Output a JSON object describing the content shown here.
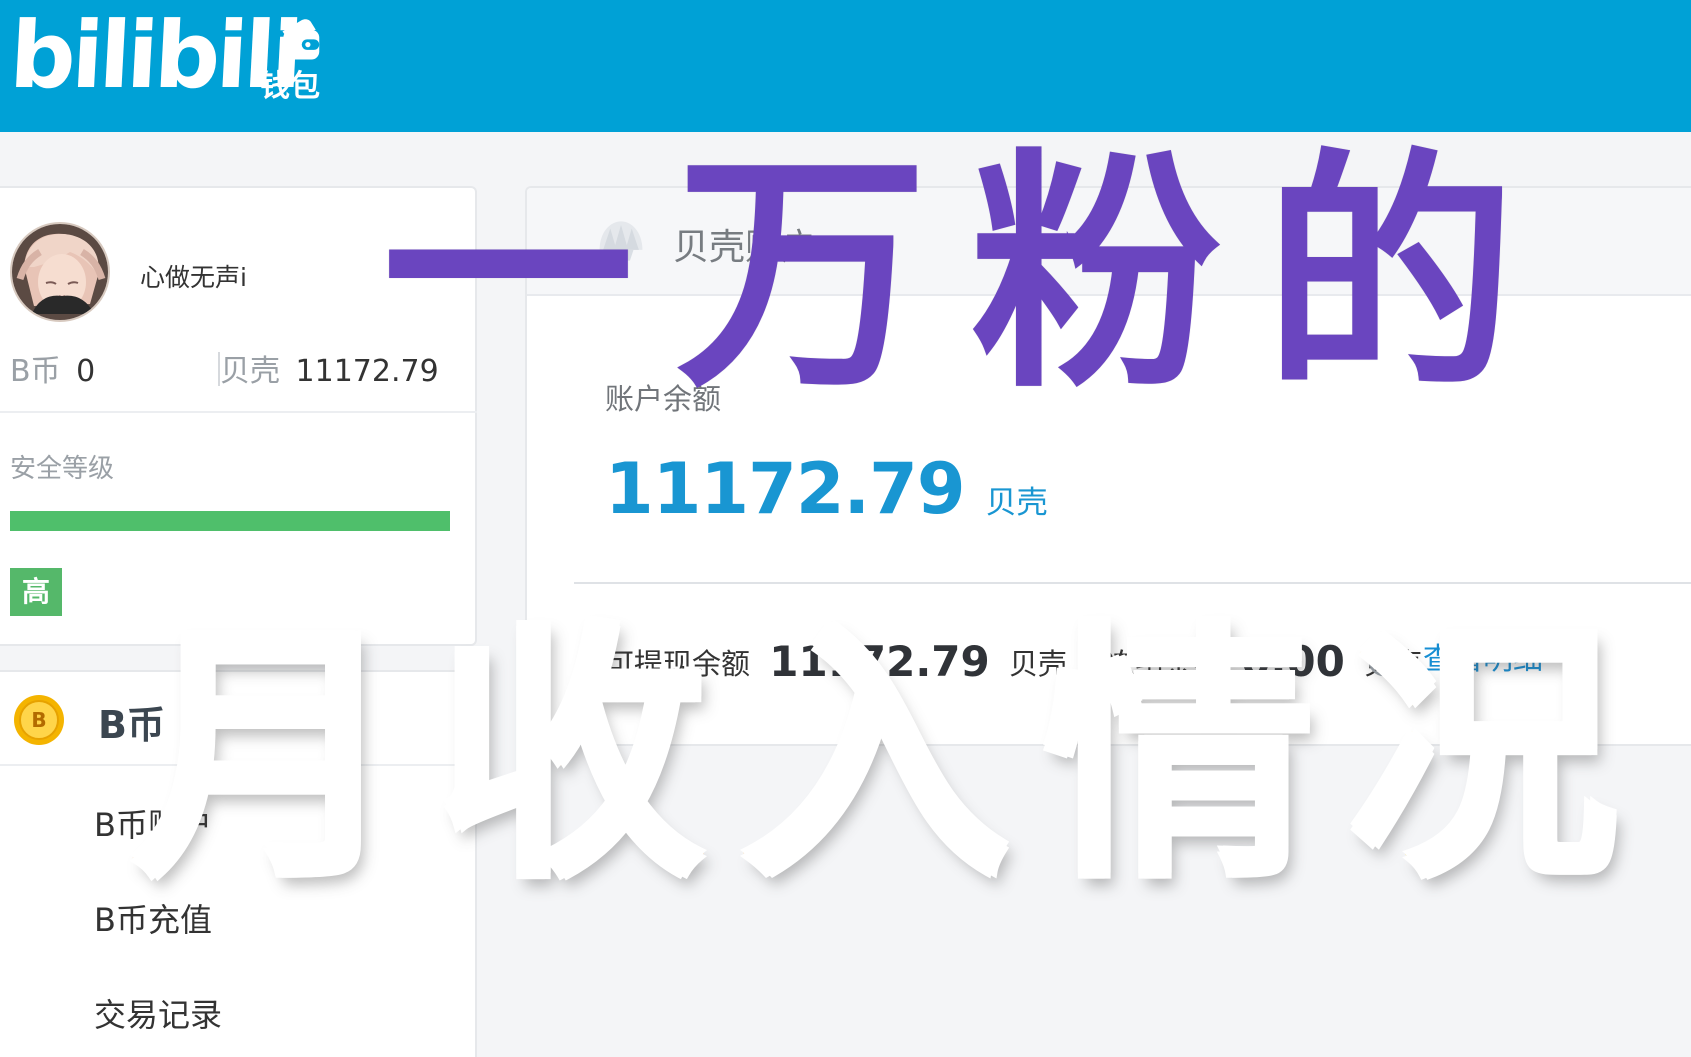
{
  "header": {
    "brand_text": "bilibili",
    "wallet_label": "钱包",
    "background_color": "#00a1d6"
  },
  "profile": {
    "username": "心做无声i",
    "bcoin_label": "B币",
    "bcoin_value": "0",
    "shell_label": "贝壳",
    "shell_value": "11172.79",
    "security_label": "安全等级",
    "security_level": "高",
    "security_progress": 1.0
  },
  "bcoin_section": {
    "title": "B币",
    "menu": [
      {
        "label": "B币账户"
      },
      {
        "label": "B币充值"
      },
      {
        "label": "交易记录"
      }
    ]
  },
  "shell_account": {
    "title": "贝壳账户",
    "balance_label": "账户余额",
    "balance_value": "11172.79",
    "balance_unit": "贝壳",
    "withdrawable_label": "可提现余额",
    "withdrawable_value": "11172.79",
    "withdrawable_unit": "贝壳",
    "frozen_label": "冻结余额",
    "frozen_value": "0.00",
    "frozen_unit": "贝壳",
    "details_link": "查看明细"
  },
  "overlay": {
    "top_text": "一万粉的",
    "bottom_text": "月收入情况",
    "top_color": "#6a45bf",
    "bottom_gradient": [
      "#ff6a00",
      "#ff9300",
      "#ffbf00",
      "#ffe100"
    ]
  },
  "icons": {
    "avatar": "avatar",
    "wallet": "wallet-icon",
    "shell": "shell-icon",
    "bcoin": "bcoin-icon",
    "info": "info-icon"
  }
}
